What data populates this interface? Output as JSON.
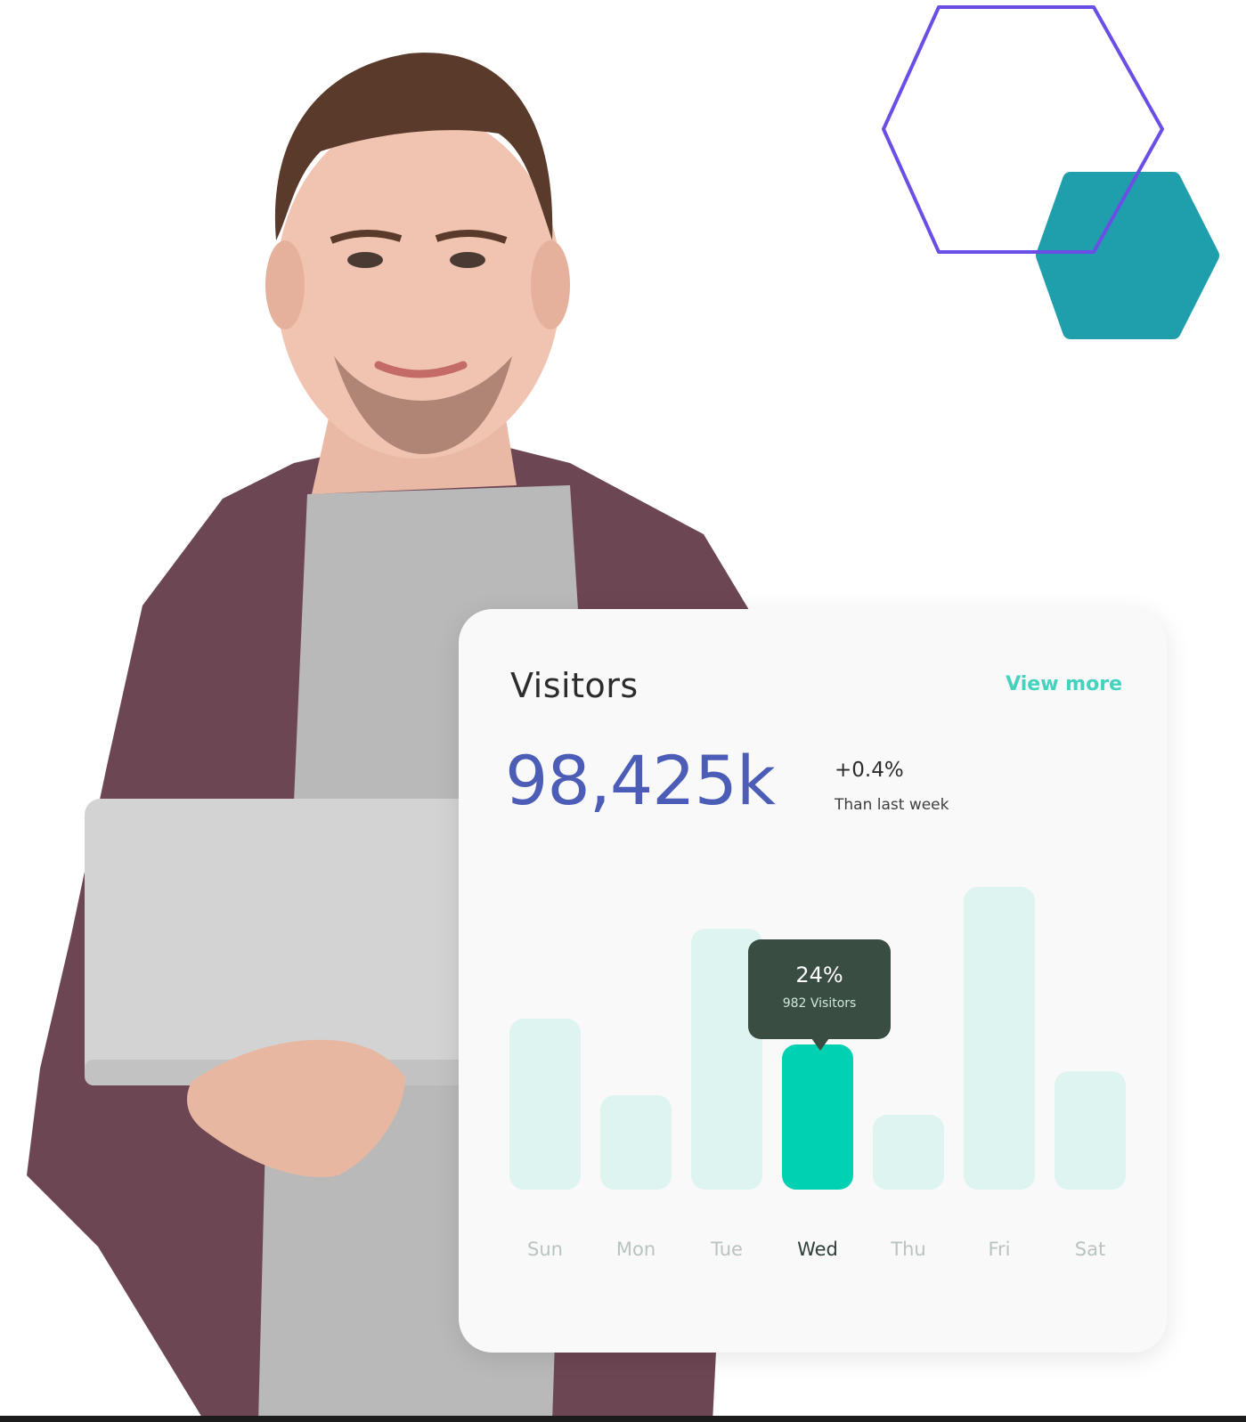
{
  "card": {
    "title": "Visitors",
    "view_more": "View more",
    "total": "98,425k",
    "change_pct": "+0.4%",
    "change_label": "Than last week"
  },
  "tooltip": {
    "pct": "24%",
    "visitors": "982 Visitors"
  },
  "colors": {
    "accent": "#00d1b2",
    "bar_muted": "#d8f3ee",
    "number": "#4c5db8",
    "link": "#45d3bf",
    "tooltip_bg": "#3a4d43",
    "hex_outline": "#6b4ee6",
    "hex_fill": "#1f9fab"
  },
  "chart_data": {
    "type": "bar",
    "categories": [
      "Sun",
      "Mon",
      "Tue",
      "Wed",
      "Thu",
      "Fri",
      "Sat"
    ],
    "values": [
      192,
      106,
      293,
      163,
      84,
      340,
      133
    ],
    "highlight_index": 3,
    "ylim": [
      0,
      340
    ]
  }
}
